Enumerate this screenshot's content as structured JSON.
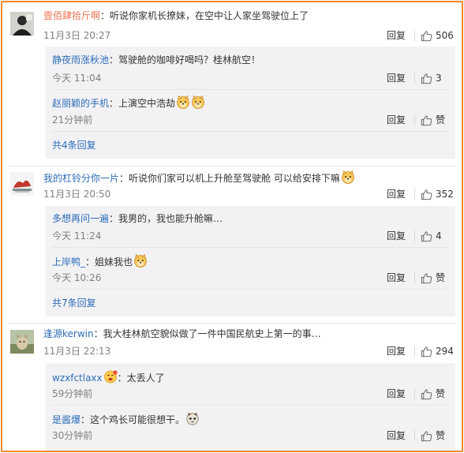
{
  "threads": [
    {
      "user": "壹佰肆拾斤啊",
      "text": "：听说你家机长撩妹，在空中让人家坐驾驶位上了",
      "time": "11月3日 20:27",
      "reply_label": "回复",
      "likes": "506",
      "replies": [
        {
          "user": "静夜雨涨秋池",
          "text": "：驾驶舱的咖啡好喝吗？桂林航空！",
          "time": "今天 11:04",
          "reply_label": "回复",
          "likes": "3"
        },
        {
          "user": "赵丽颖的手机",
          "text": "：上演空中浩劫",
          "time": "21分钟前",
          "reply_label": "回复",
          "likes": "赞"
        }
      ],
      "more": "共4条回复"
    },
    {
      "user": "我的杠铃分你一片",
      "text": "：听说你们家可以机上升舱至驾驶舱  可以给安排下嘛",
      "time": "11月3日 20:50",
      "reply_label": "回复",
      "likes": "352",
      "replies": [
        {
          "user": "多想再问一遍",
          "text": "：我男的，我也能升舱嘛…",
          "time": "今天 11:24",
          "reply_label": "回复",
          "likes": "4"
        },
        {
          "user": "上岸鸭_",
          "text": "：姐妹我也",
          "time": "今天 10:26",
          "reply_label": "回复",
          "likes": "赞"
        }
      ],
      "more": "共7条回复"
    },
    {
      "user": "逢源kerwin",
      "text": "：我大桂林航空貌似做了一件中国民航史上第一的事…",
      "time": "11月3日 22:13",
      "reply_label": "回复",
      "likes": "294",
      "replies": [
        {
          "user": "wzxfctlaxx",
          "text": "：太丢人了",
          "time": "59分钟前",
          "reply_label": "回复",
          "likes": "赞"
        },
        {
          "user": "是酱爆",
          "text": "：这个鸡长可能很想干。",
          "time": "30分钟前",
          "reply_label": "回复",
          "likes": "赞"
        }
      ]
    }
  ],
  "icons": {
    "like": "thumbs-up-icon",
    "emoji": "doge-emoji-icon"
  },
  "colors": {
    "frame": "#f08a2c",
    "username": "#eb7350",
    "link": "#2c6db5",
    "subbox": "#f2f2f5"
  }
}
